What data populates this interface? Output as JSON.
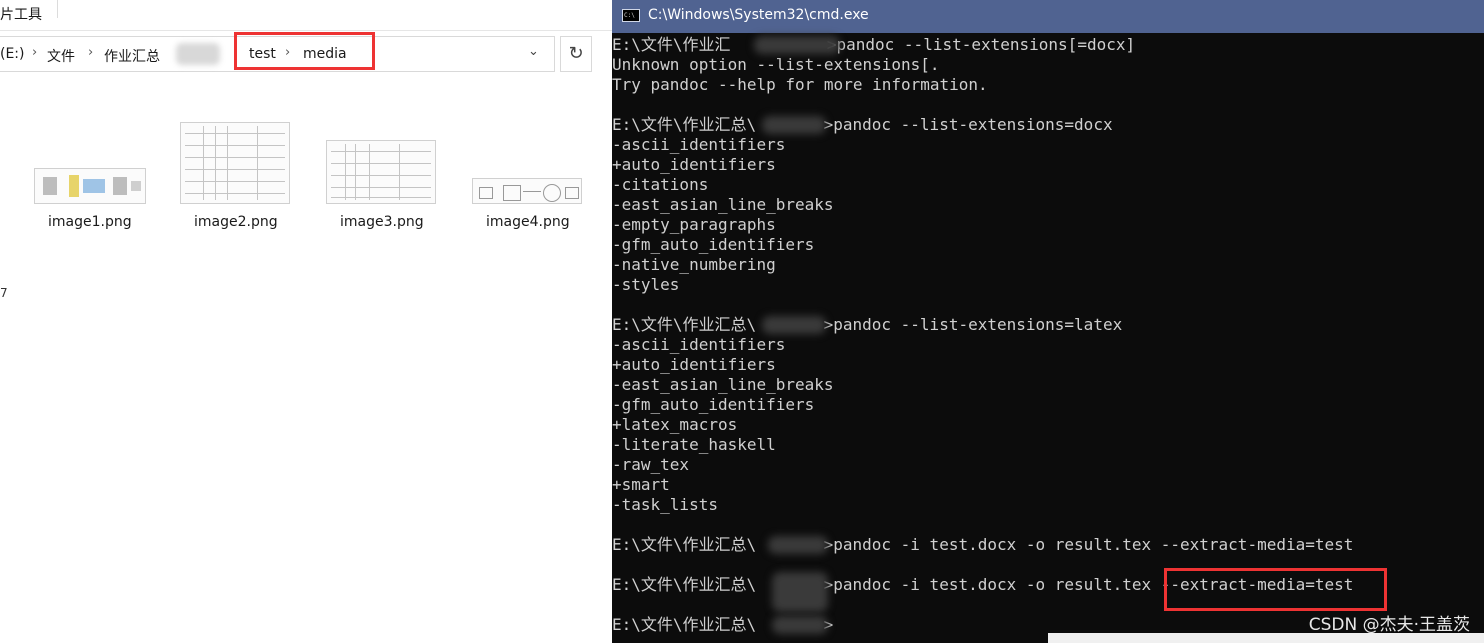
{
  "explorer": {
    "ribbon_tab": "片工具",
    "breadcrumb": [
      {
        "label": "(E:)"
      },
      {
        "label": "文件"
      },
      {
        "label": "作业汇总"
      },
      {
        "label": "test"
      },
      {
        "label": "media"
      }
    ],
    "dropdown_glyph": "⌄",
    "refresh_glyph": "↻",
    "left_edge_mark": "7",
    "files": [
      {
        "name": "image1.png"
      },
      {
        "name": "image2.png"
      },
      {
        "name": "image3.png"
      },
      {
        "name": "image4.png"
      }
    ]
  },
  "cmd": {
    "title": "C:\\Windows\\System32\\cmd.exe",
    "icon_text": "C:\\",
    "lines": [
      "E:\\文件\\作业汇          >pandoc --list-extensions[=docx]",
      "Unknown option --list-extensions[.",
      "Try pandoc --help for more information.",
      "",
      "E:\\文件\\作业汇总\\       >pandoc --list-extensions=docx",
      "-ascii_identifiers",
      "+auto_identifiers",
      "-citations",
      "-east_asian_line_breaks",
      "-empty_paragraphs",
      "-gfm_auto_identifiers",
      "-native_numbering",
      "-styles",
      "",
      "E:\\文件\\作业汇总\\       >pandoc --list-extensions=latex",
      "-ascii_identifiers",
      "+auto_identifiers",
      "-east_asian_line_breaks",
      "-gfm_auto_identifiers",
      "+latex_macros",
      "-literate_haskell",
      "-raw_tex",
      "+smart",
      "-task_lists",
      "",
      "E:\\文件\\作业汇总\\       >pandoc -i test.docx -o result.tex --extract-media=test",
      "",
      "E:\\文件\\作业汇总\\       >pandoc -i test.docx -o result.tex --extract-media=test",
      "",
      "E:\\文件\\作业汇总\\       >"
    ]
  },
  "watermark": "CSDN @杰夫·王盖茨"
}
